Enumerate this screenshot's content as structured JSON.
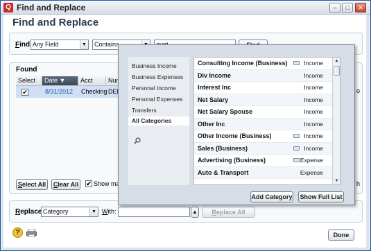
{
  "window": {
    "title": "Find and Replace",
    "minimize": "–",
    "maximize": "□",
    "close": "✕"
  },
  "heading": "Find and Replace",
  "find": {
    "label_u": "F",
    "label_rest": "ind",
    "field_value": "Any Field",
    "operator_value": "Contains",
    "search_value": "aunt",
    "find_button": "Find"
  },
  "found": {
    "label": "Found",
    "columns": {
      "select": "Select",
      "date": "Date",
      "acct": "Acct",
      "num": "Num"
    },
    "rows": [
      {
        "checked": "✔",
        "date": "8/31/2012",
        "acct": "Checking",
        "num": "DEP"
      }
    ],
    "select_all_u": "S",
    "select_all_rest": "elect All",
    "clear_all_u": "C",
    "clear_all_rest": "lear All",
    "show_matches": "Show mat",
    "edge_h": "h",
    "edge_o": "o"
  },
  "replace": {
    "label_u": "R",
    "label_rest": "eplace",
    "field_value": "Category",
    "with_u": "W",
    "with_rest": "ith:",
    "with_value": "",
    "replace_all_u": "R",
    "replace_all_rest": "eplace All"
  },
  "footer": {
    "done": "Done"
  },
  "category_popup": {
    "groups": [
      "Business Income",
      "Business Expenses",
      "Personal Income",
      "Personal Expenses",
      "Transfers",
      "All Categories"
    ],
    "selected_group": "All Categories",
    "items": [
      {
        "name": "Consulting Income (Business)",
        "type": "Income",
        "business": true
      },
      {
        "name": "Div Income",
        "type": "Income",
        "business": false
      },
      {
        "name": "Interest Inc",
        "type": "Income",
        "business": false
      },
      {
        "name": "Net Salary",
        "type": "Income",
        "business": false
      },
      {
        "name": "Net Salary Spouse",
        "type": "Income",
        "business": false
      },
      {
        "name": "Other Inc",
        "type": "Income",
        "business": false
      },
      {
        "name": "Other Income (Business)",
        "type": "Income",
        "business": true
      },
      {
        "name": "Sales (Business)",
        "type": "Income",
        "business": true
      },
      {
        "name": "Advertising (Business)",
        "type": "Expense",
        "business": true
      },
      {
        "name": "Auto & Transport",
        "type": "Expense",
        "business": false
      }
    ],
    "add_category": "Add Category",
    "show_full_list": "Show Full List"
  },
  "colors": {
    "accent": "#1c5a9c",
    "selection": "#cfe0f4",
    "date_link": "#1f4fb3"
  }
}
